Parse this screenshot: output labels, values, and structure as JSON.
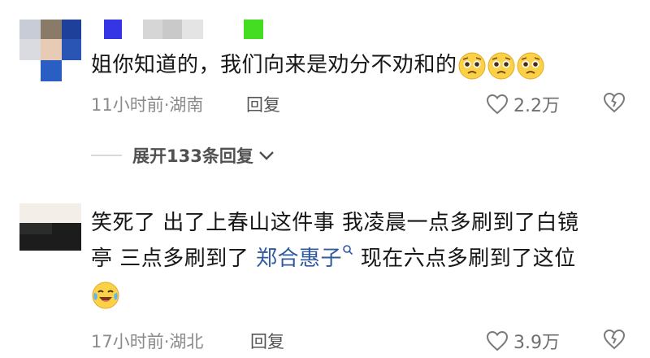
{
  "comments": [
    {
      "text": "姐你知道的，我们向来是劝分不劝和的",
      "meta": "11小时前·湖南",
      "reply_label": "回复",
      "likes": "2.2万",
      "emoji_count": 3,
      "name_block_colors": [
        "#3535e6",
        "#d6d6d6",
        "#c9c9c9",
        "#e4e4e4",
        "#44dd22"
      ]
    },
    {
      "text_line1": "笑死了 出了上春山这件事 我凌晨一点多刷到了白镜",
      "text_line2_pre": "亭 三点多刷到了",
      "link_name": "郑合惠子",
      "text_line2_post": " 现在六点多刷到了这位",
      "meta": "17小时前·湖北",
      "reply_label": "回复",
      "likes": "3.9万"
    }
  ],
  "expand_replies": "展开133条回复",
  "icons": {
    "like": "heart-outline-icon",
    "dislike": "broken-heart-icon",
    "expand": "chevron-down-icon",
    "search": "search-icon",
    "emoji1": "pleading-face-emoji-icon",
    "emoji2": "crying-laughing-emoji-icon"
  },
  "colors": {
    "link": "#2f5a9e",
    "meta": "#8a8a8a",
    "text": "#161616"
  }
}
